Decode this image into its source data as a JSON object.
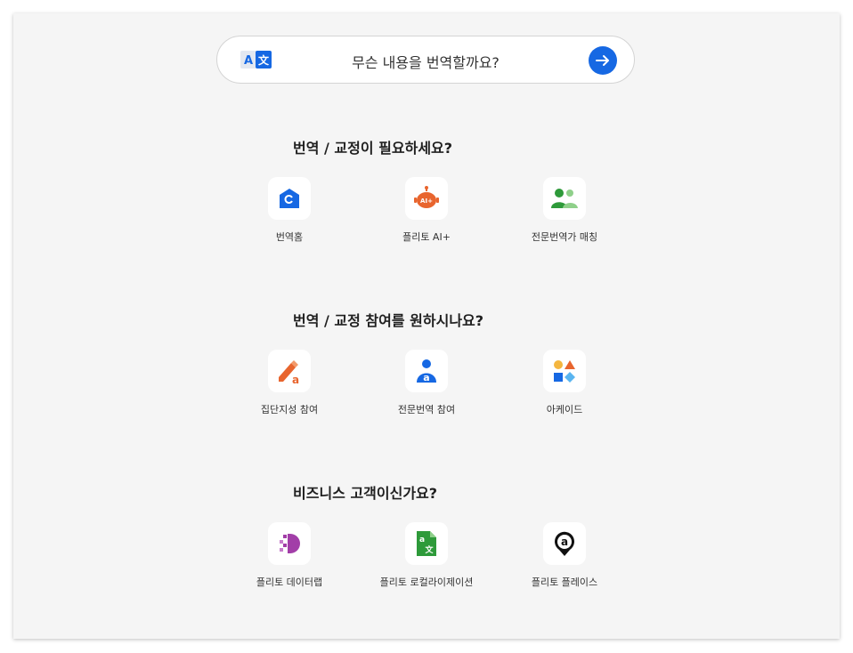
{
  "search": {
    "placeholder_text": "무슨 내용을 번역할까요?",
    "translate_icon_letters": [
      "A",
      "文"
    ],
    "accent": "#1668e3"
  },
  "sections": [
    {
      "title": "번역 / 교정이 필요하세요?",
      "items": [
        {
          "label": "번역홈",
          "icon": "translation-home-icon"
        },
        {
          "label": "플리토 AI+",
          "icon": "ai-plus-icon",
          "badge": "AI+"
        },
        {
          "label": "전문번역가 매칭",
          "icon": "translator-matching-icon"
        }
      ]
    },
    {
      "title": "번역 / 교정 참여를 원하시나요?",
      "items": [
        {
          "label": "집단지성 참여",
          "icon": "crowd-pencil-icon",
          "badge": "a"
        },
        {
          "label": "전문번역 참여",
          "icon": "pro-translator-icon",
          "badge": "a"
        },
        {
          "label": "아케이드",
          "icon": "arcade-shapes-icon"
        }
      ]
    },
    {
      "title": "비즈니스 고객이신가요?",
      "items": [
        {
          "label": "플리토 데이터랩",
          "icon": "datalab-icon"
        },
        {
          "label": "플리토 로컬라이제이션",
          "icon": "localization-icon",
          "badge": [
            "a",
            "文"
          ]
        },
        {
          "label": "플리토 플레이스",
          "icon": "place-pin-icon",
          "badge": "a"
        }
      ]
    }
  ]
}
